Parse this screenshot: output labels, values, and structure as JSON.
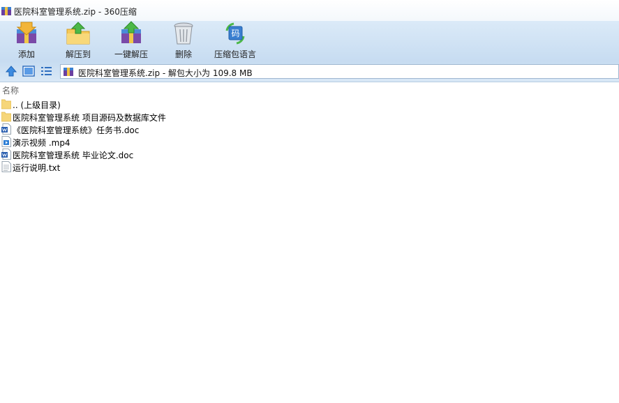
{
  "window": {
    "title": "医院科室管理系统.zip - 360压缩"
  },
  "toolbar": {
    "add_label": "添加",
    "extract_to_label": "解压到",
    "one_click_label": "一键解压",
    "delete_label": "删除",
    "language_label": "压缩包语言",
    "language_icon_char": "码"
  },
  "navbar": {
    "path": "医院科室管理系统.zip - 解包大小为 109.8 MB"
  },
  "list": {
    "column_name": "名称",
    "items": [
      {
        "name": ".. (上级目录)",
        "icon": "folder-icon"
      },
      {
        "name": "医院科室管理系统 项目源码及数据库文件",
        "icon": "folder-icon"
      },
      {
        "name": "《医院科室管理系统》任务书.doc",
        "icon": "word-doc-icon"
      },
      {
        "name": "演示视频 .mp4",
        "icon": "video-file-icon"
      },
      {
        "name": "医院科室管理系统 毕业论文.doc",
        "icon": "word-doc-icon"
      },
      {
        "name": "运行说明.txt",
        "icon": "text-file-icon"
      }
    ]
  },
  "colors": {
    "toolbar_bg": "#d0e2f4",
    "folder": "#f6d67a",
    "word_blue": "#2a5fb0",
    "accent_blue": "#3a7fd0"
  }
}
